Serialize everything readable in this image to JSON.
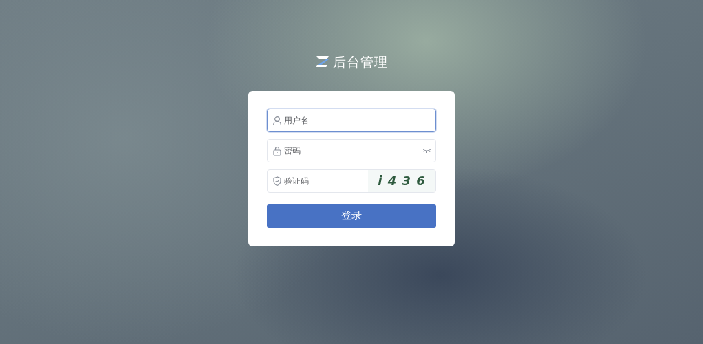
{
  "logo": {
    "title": "后台管理"
  },
  "fields": [
    {
      "kind": "username",
      "placeholder": "用户名",
      "focused": true
    },
    {
      "kind": "password",
      "placeholder": "密码",
      "focused": false
    },
    {
      "kind": "captcha",
      "placeholder": "验证码",
      "focused": false,
      "code": "i 4 3 6"
    }
  ],
  "submit": {
    "label": "登录"
  }
}
